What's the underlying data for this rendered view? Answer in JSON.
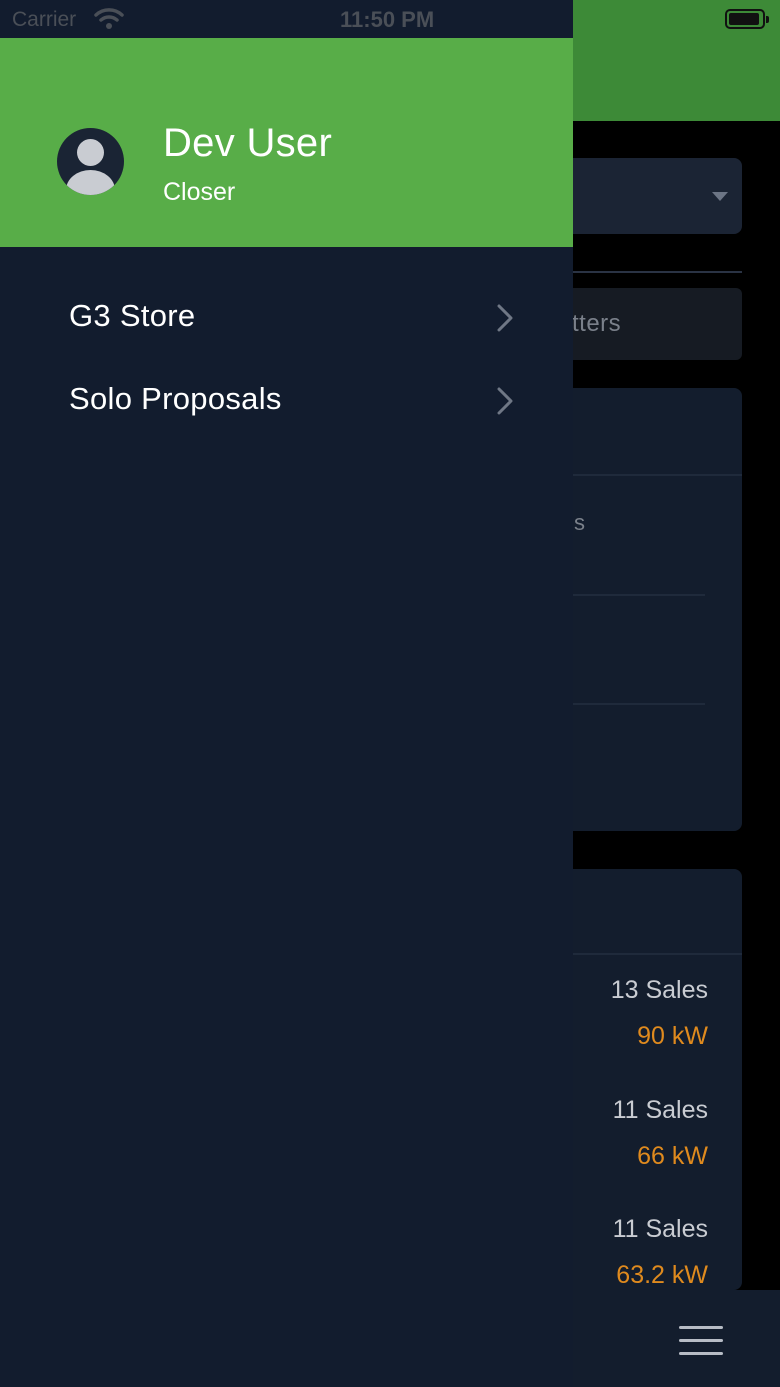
{
  "status_bar": {
    "carrier": "Carrier",
    "time": "11:50 PM"
  },
  "drawer": {
    "user": {
      "name": "Dev User",
      "role": "Closer"
    },
    "menu": [
      {
        "label": "G3 Store"
      },
      {
        "label": "Solo Proposals"
      }
    ]
  },
  "background": {
    "filter_partial": "tters",
    "card_partial": "s",
    "sales": [
      {
        "count": "13 Sales",
        "kw": "90 kW"
      },
      {
        "count": "11 Sales",
        "kw": "66 kW"
      },
      {
        "count": "11 Sales",
        "kw": "63.2 kW"
      }
    ]
  },
  "colors": {
    "header_green": "#58ad48",
    "drawer_bg": "#121c2e",
    "kw_orange": "#df8a1e"
  }
}
